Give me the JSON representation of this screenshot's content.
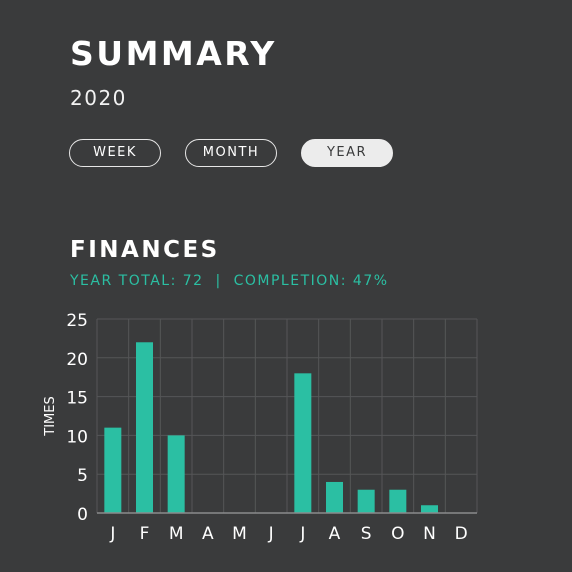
{
  "header": {
    "title": "SUMMARY",
    "year": "2020"
  },
  "tabs": [
    {
      "label": "WEEK",
      "selected": false
    },
    {
      "label": "MONTH",
      "selected": false
    },
    {
      "label": "YEAR",
      "selected": true
    }
  ],
  "section": {
    "title": "FINANCES",
    "year_total_label": "YEAR TOTAL:",
    "year_total_value": "72",
    "separator": "|",
    "completion_label": "COMPLETION:",
    "completion_value": "47%"
  },
  "colors": {
    "background": "#3a3b3c",
    "accent": "#2bbfa3",
    "text": "#ffffff",
    "grid": "#555657"
  },
  "chart_data": {
    "type": "bar",
    "categories": [
      "J",
      "F",
      "M",
      "A",
      "M",
      "J",
      "J",
      "A",
      "S",
      "O",
      "N",
      "D"
    ],
    "values": [
      11,
      22,
      10,
      0,
      0,
      0,
      18,
      4,
      3,
      3,
      1,
      0
    ],
    "ylabel": "TIMES",
    "ylim": [
      0,
      25
    ],
    "yticks": [
      0,
      5,
      10,
      15,
      20,
      25
    ],
    "grid": true
  }
}
